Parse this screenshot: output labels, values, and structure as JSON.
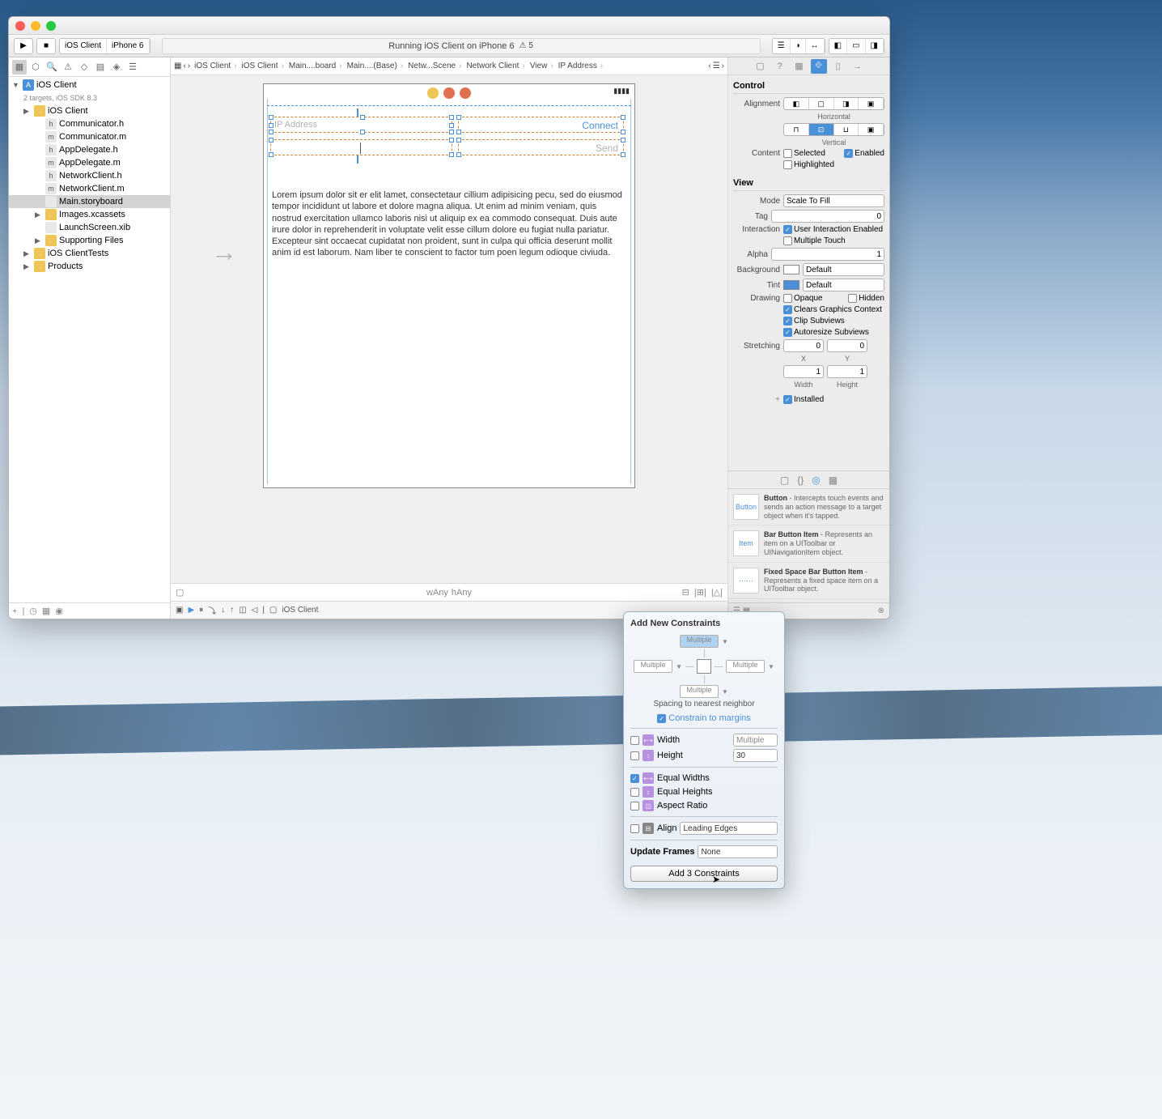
{
  "toolbar": {
    "scheme": "iOS Client",
    "device": "iPhone 6",
    "status": "Running iOS Client on iPhone 6",
    "warnings": "5"
  },
  "navigator": {
    "project": "iOS Client",
    "subtitle": "2 targets, iOS SDK 8.3",
    "tree": [
      {
        "label": "iOS Client",
        "type": "folder",
        "indent": 1
      },
      {
        "label": "Communicator.h",
        "type": "h",
        "indent": 2
      },
      {
        "label": "Communicator.m",
        "type": "m",
        "indent": 2
      },
      {
        "label": "AppDelegate.h",
        "type": "h",
        "indent": 2
      },
      {
        "label": "AppDelegate.m",
        "type": "m",
        "indent": 2
      },
      {
        "label": "NetworkClient.h",
        "type": "h",
        "indent": 2
      },
      {
        "label": "NetworkClient.m",
        "type": "m",
        "indent": 2
      },
      {
        "label": "Main.storyboard",
        "type": "sb",
        "indent": 2,
        "sel": true
      },
      {
        "label": "Images.xcassets",
        "type": "folder",
        "indent": 2
      },
      {
        "label": "LaunchScreen.xib",
        "type": "xib",
        "indent": 2
      },
      {
        "label": "Supporting Files",
        "type": "folder",
        "indent": 2
      },
      {
        "label": "iOS ClientTests",
        "type": "folder",
        "indent": 1
      },
      {
        "label": "Products",
        "type": "folder",
        "indent": 1
      }
    ]
  },
  "jumpbar": [
    "iOS Client",
    "iOS Client",
    "Main....board",
    "Main....(Base)",
    "Netw...Scene",
    "Network Client",
    "View",
    "IP Address"
  ],
  "canvas": {
    "ip_placeholder": "IP Address",
    "connect": "Connect",
    "send": "Send",
    "lorem": "Lorem ipsum dolor sit er elit lamet, consectetaur cillium adipisicing pecu, sed do eiusmod tempor incididunt ut labore et dolore magna aliqua. Ut enim ad minim veniam, quis nostrud exercitation ullamco laboris nisi ut aliquip ex ea commodo consequat. Duis aute irure dolor in reprehenderit in voluptate velit esse cillum dolore eu fugiat nulla pariatur. Excepteur sint occaecat cupidatat non proident, sunt in culpa qui officia deserunt mollit anim id est laborum. Nam liber te conscient to factor tum poen legum odioque civiuda.",
    "size_class": {
      "w": "wAny",
      "h": "hAny"
    }
  },
  "debug": {
    "target": "iOS Client"
  },
  "inspector": {
    "control_header": "Control",
    "alignment_label": "Alignment",
    "horizontal": "Horizontal",
    "vertical": "Vertical",
    "content_label": "Content",
    "selected": "Selected",
    "enabled": "Enabled",
    "highlighted": "Highlighted",
    "view_header": "View",
    "mode_label": "Mode",
    "mode_value": "Scale To Fill",
    "tag_label": "Tag",
    "tag_value": "0",
    "interaction_label": "Interaction",
    "uie": "User Interaction Enabled",
    "mt": "Multiple Touch",
    "alpha_label": "Alpha",
    "alpha_value": "1",
    "bg_label": "Background",
    "bg_value": "Default",
    "tint_label": "Tint",
    "tint_value": "Default",
    "drawing_label": "Drawing",
    "opaque": "Opaque",
    "hidden": "Hidden",
    "cgc": "Clears Graphics Context",
    "cs": "Clip Subviews",
    "as": "Autoresize Subviews",
    "stretch_label": "Stretching",
    "sx": "0",
    "sy": "0",
    "sw": "1",
    "sh": "1",
    "x": "X",
    "y": "Y",
    "w": "Width",
    "h": "Height",
    "installed": "Installed"
  },
  "library": {
    "items": [
      {
        "icon": "Button",
        "title": "Button",
        "desc": " - Intercepts touch events and sends an action message to a target object when it's tapped."
      },
      {
        "icon": "Item",
        "title": "Bar Button Item",
        "desc": " - Represents an item on a UIToolbar or UINavigationItem object."
      },
      {
        "icon": "······",
        "title": "Fixed Space Bar Button Item",
        "desc": " - Represents a fixed space item on a UIToolbar object."
      }
    ]
  },
  "popover": {
    "title": "Add New Constraints",
    "multiple": "Multiple",
    "spacing": "Spacing to nearest neighbor",
    "constrain": "Constrain to margins",
    "width": "Width",
    "height": "Height",
    "height_val": "30",
    "eq_w": "Equal Widths",
    "eq_h": "Equal Heights",
    "aspect": "Aspect Ratio",
    "align": "Align",
    "align_val": "Leading Edges",
    "upd": "Update Frames",
    "upd_val": "None",
    "add": "Add 3 Constraints"
  }
}
